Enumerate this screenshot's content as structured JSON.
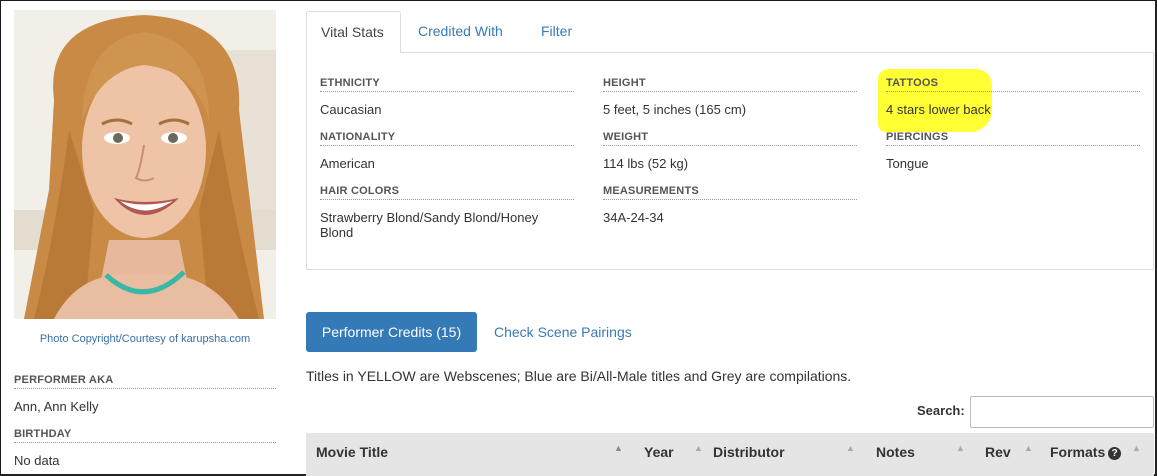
{
  "photo": {
    "alt": "performer headshot",
    "copyright": "Photo Copyright/Courtesy of karupsha.com"
  },
  "sidebar": {
    "aka_label": "PERFORMER AKA",
    "aka_value": "Ann, Ann Kelly",
    "birthday_label": "BIRTHDAY",
    "birthday_value": "No data"
  },
  "tabs": [
    {
      "label": "Vital Stats",
      "active": true
    },
    {
      "label": "Credited With",
      "active": false
    },
    {
      "label": "Filter",
      "active": false
    }
  ],
  "stats": {
    "ethnicity": {
      "label": "ETHNICITY",
      "value": "Caucasian"
    },
    "nationality": {
      "label": "NATIONALITY",
      "value": "American"
    },
    "hair_colors": {
      "label": "HAIR COLORS",
      "value": "Strawberry Blond/Sandy Blond/Honey Blond"
    },
    "height": {
      "label": "HEIGHT",
      "value": "5 feet, 5 inches (165 cm)"
    },
    "weight": {
      "label": "WEIGHT",
      "value": "114 lbs (52 kg)"
    },
    "measurements": {
      "label": "MEASUREMENTS",
      "value": "34A-24-34"
    },
    "tattoos": {
      "label": "TATTOOS",
      "value": "4 stars lower back"
    },
    "piercings": {
      "label": "PIERCINGS",
      "value": "Tongue"
    }
  },
  "highlight_color": "#ffff33",
  "accent_color": "#337ab7",
  "credits": {
    "button_label": "Performer Credits (15)",
    "pairings_label": "Check Scene Pairings",
    "note": "Titles in YELLOW are Webscenes; Blue are Bi/All-Male titles and Grey are compilations.",
    "search_label": "Search:",
    "search_value": ""
  },
  "table": {
    "columns": [
      {
        "label": "Movie Title",
        "sort_icon": "sort-up-icon"
      },
      {
        "label": "Year",
        "sort_icon": "sort-icon"
      },
      {
        "label": "Distributor",
        "sort_icon": "sort-icon"
      },
      {
        "label": "Notes",
        "sort_icon": "sort-icon"
      },
      {
        "label": "Rev",
        "sort_icon": "sort-icon"
      },
      {
        "label": "Formats",
        "sort_icon": "sort-icon",
        "help_icon": "question-circle-icon"
      }
    ]
  }
}
